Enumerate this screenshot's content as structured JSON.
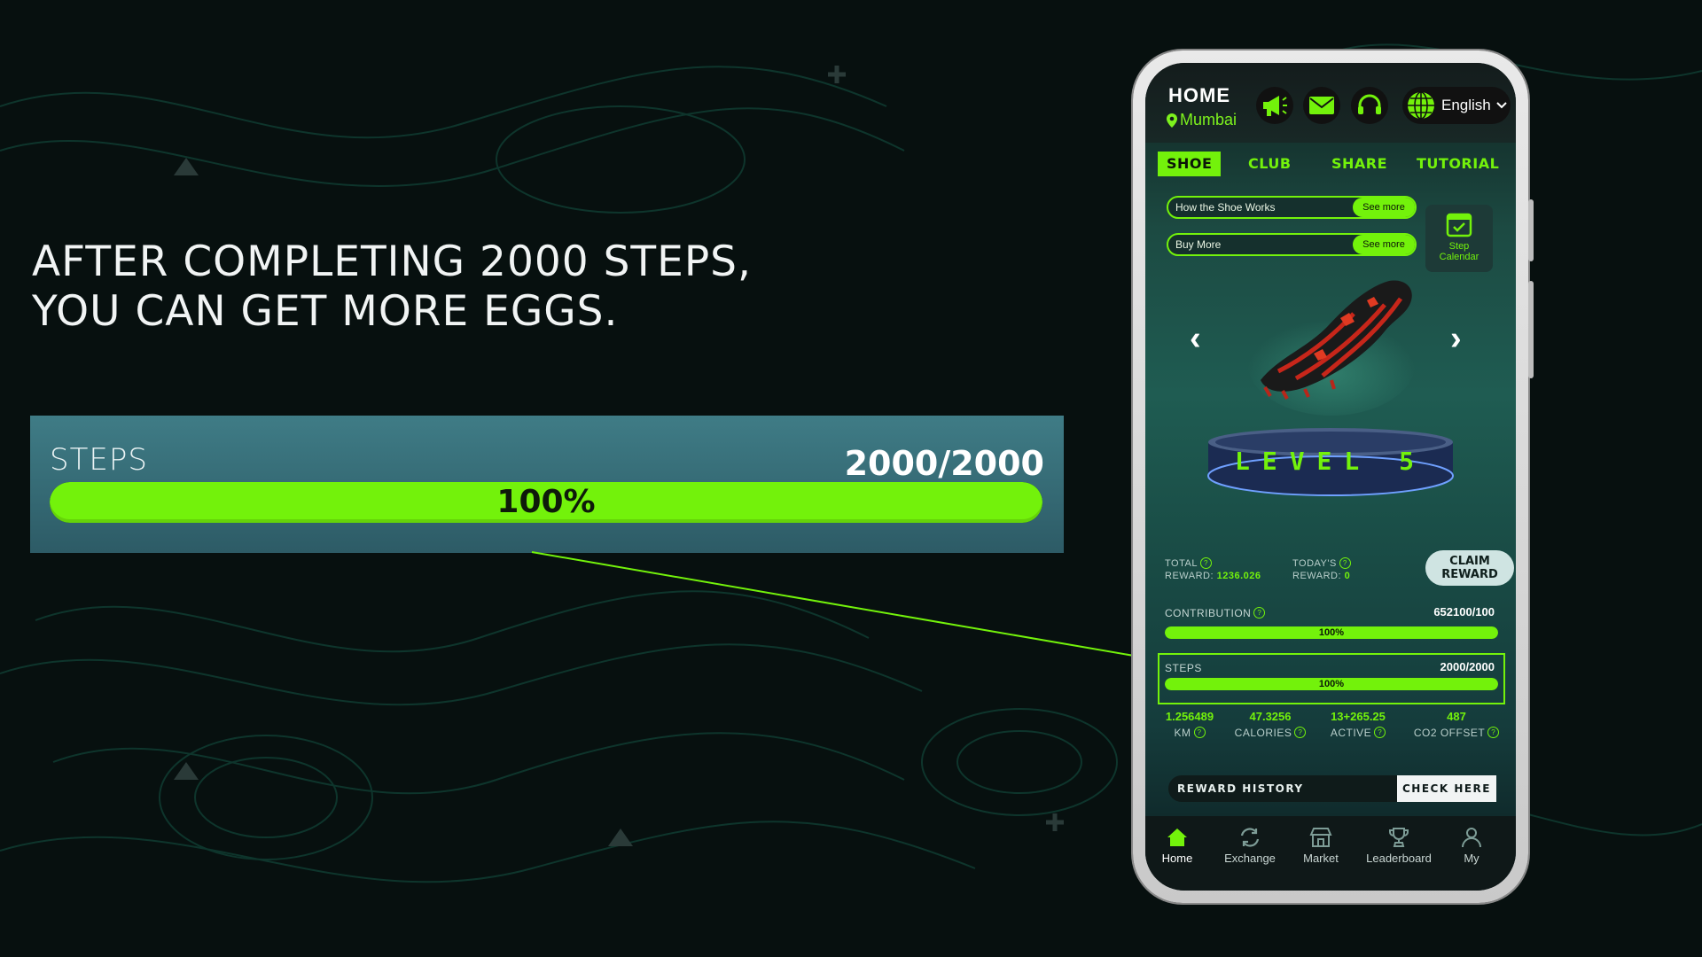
{
  "headline": {
    "line1": "AFTER COMPLETING 2000 STEPS,",
    "line2": "YOU CAN GET MORE EGGS."
  },
  "steps_panel": {
    "label": "STEPS",
    "value": "2000/2000",
    "percent_text": "100%",
    "progress": 1.0
  },
  "phone": {
    "header": {
      "title": "HOME",
      "location": "Mumbai",
      "language": "English"
    },
    "tabs": [
      {
        "label": "SHOE",
        "active": true
      },
      {
        "label": "CLUB",
        "active": false
      },
      {
        "label": "SHARE",
        "active": false
      },
      {
        "label": "TUTORIAL",
        "active": false
      }
    ],
    "info_rows": [
      {
        "label": "How the Shoe Works",
        "action": "See more"
      },
      {
        "label": "Buy More",
        "action": "See more"
      }
    ],
    "calendar": {
      "line1": "Step",
      "line2": "Calendar"
    },
    "level": "LEVEL 5",
    "rewards": {
      "total_label_1": "TOTAL",
      "total_label_2": "REWARD:",
      "total_value": "1236.026",
      "today_label_1": "TODAY'S",
      "today_label_2": "REWARD:",
      "today_value": "0",
      "claim_line1": "CLAIM",
      "claim_line2": "REWARD"
    },
    "contribution": {
      "label": "CONTRIBUTION",
      "value": "652100/100",
      "percent_text": "100%",
      "progress": 1.0
    },
    "steps": {
      "label": "STEPS",
      "value": "2000/2000",
      "percent_text": "100%",
      "progress": 1.0
    },
    "metrics": [
      {
        "value": "1.256489",
        "label": "KM"
      },
      {
        "value": "47.3256",
        "label": "CALORIES"
      },
      {
        "value": "13+265.25",
        "label": "ACTIVE"
      },
      {
        "value": "487",
        "label": "CO2 OFFSET"
      }
    ],
    "reward_history": {
      "label": "REWARD HISTORY",
      "action": "CHECK HERE"
    },
    "nav": [
      {
        "label": "Home",
        "icon": "home-icon",
        "active": true
      },
      {
        "label": "Exchange",
        "icon": "exchange-icon",
        "active": false
      },
      {
        "label": "Market",
        "icon": "market-icon",
        "active": false
      },
      {
        "label": "Leaderboard",
        "icon": "trophy-icon",
        "active": false
      },
      {
        "label": "My",
        "icon": "user-icon",
        "active": false
      }
    ]
  },
  "colors": {
    "accent": "#73f20b",
    "background": "#07100f",
    "panel": "#3f7c86"
  }
}
